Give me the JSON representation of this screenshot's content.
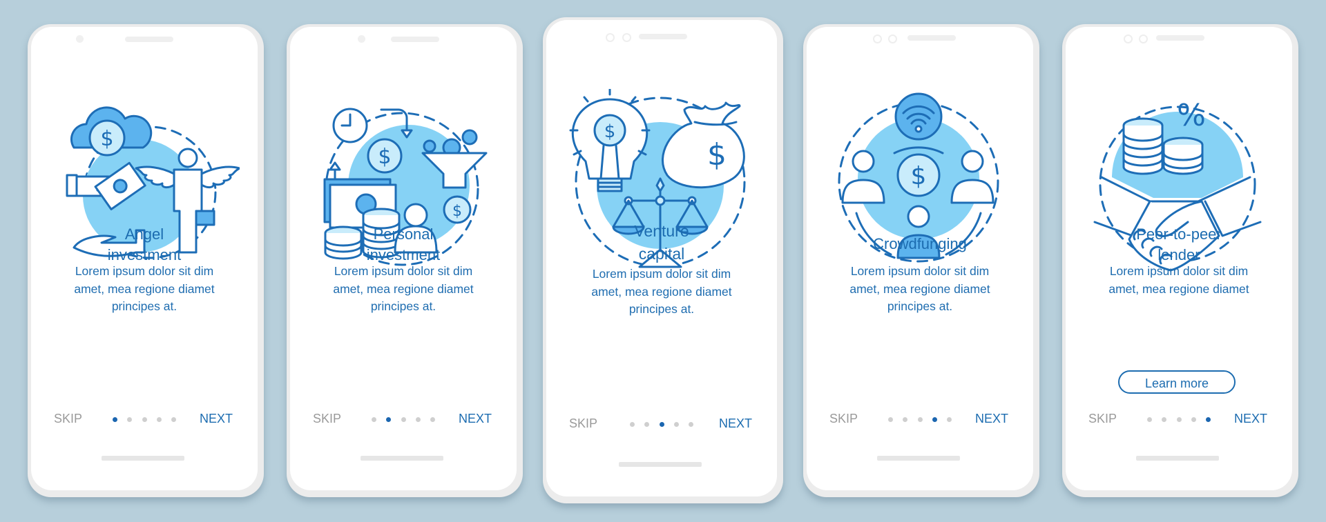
{
  "colors": {
    "background": "#b7cfdb",
    "accent": "#1c6cb0",
    "light_fill": "#86d2f5",
    "mid_fill": "#5cb3ee",
    "pale_fill": "#c9ecfb",
    "dot_inactive": "#cfcfcf",
    "skip_text": "#9a9a9a"
  },
  "screens": [
    {
      "illustration": "angel-investment-illustration",
      "title_lines": [
        "Angel",
        "investment"
      ],
      "body_lines": [
        "Lorem ipsum dolor sit dim",
        "amet, mea regione diamet",
        "principes at."
      ],
      "skip_label": "SKIP",
      "next_label": "NEXT",
      "active_page": 1,
      "total_pages": 5
    },
    {
      "illustration": "personal-investment-illustration",
      "title_lines": [
        "Personal",
        "investment"
      ],
      "body_lines": [
        "Lorem ipsum dolor sit dim",
        "amet, mea regione diamet",
        "principes at."
      ],
      "skip_label": "SKIP",
      "next_label": "NEXT",
      "active_page": 2,
      "total_pages": 5
    },
    {
      "illustration": "venture-capital-illustration",
      "title_lines": [
        "Venture",
        "capital"
      ],
      "body_lines": [
        "Lorem ipsum dolor sit dim",
        "amet, mea regione diamet",
        "principes at."
      ],
      "skip_label": "SKIP",
      "next_label": "NEXT",
      "active_page": 3,
      "total_pages": 5
    },
    {
      "illustration": "crowdfunding-illustration",
      "title_lines": [
        "Crowdfunging"
      ],
      "body_lines": [
        "Lorem ipsum dolor sit dim",
        "amet, mea regione diamet",
        "principes at."
      ],
      "skip_label": "SKIP",
      "next_label": "NEXT",
      "active_page": 4,
      "total_pages": 5
    },
    {
      "illustration": "peer-to-peer-lender-illustration",
      "title_lines": [
        "Peer-to-peer",
        "lender"
      ],
      "body_lines": [
        "Lorem ipsum dolor sit dim",
        "amet, mea regione diamet"
      ],
      "button_label": "Learn more",
      "skip_label": "SKIP",
      "next_label": "NEXT",
      "active_page": 5,
      "total_pages": 5
    }
  ],
  "icons": {
    "dollar_glyph": "$",
    "percent_glyph": "%"
  }
}
